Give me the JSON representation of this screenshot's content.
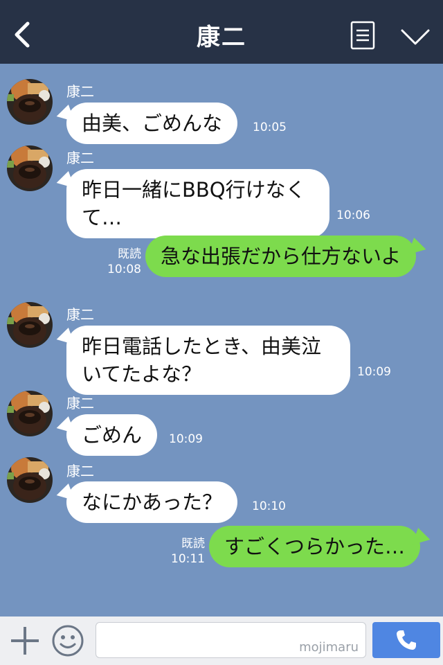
{
  "header": {
    "title": "康二",
    "back_icon": "chevron-left-icon",
    "menu_icon": "note-icon",
    "expand_icon": "chevron-down-icon",
    "bg_color": "#273246"
  },
  "chat": {
    "background_color": "#7494c0",
    "incoming_bubble_color": "#ffffff",
    "outgoing_bubble_color": "#7ddb4d",
    "messages": [
      {
        "sender": "康二",
        "text": "由美、ごめんな",
        "time": "10:05"
      },
      {
        "sender": "康二",
        "line1": "昨日一緒にBBQ行けなく",
        "line2": "て…",
        "time": "10:06"
      },
      {
        "text": "急な出張だから仕方ないよ",
        "read": "既読",
        "time": "10:08"
      },
      {
        "sender": "康二",
        "line1": "昨日電話したとき、由美泣",
        "line2": "いてたよな？",
        "time": "10:09"
      },
      {
        "sender": "康二",
        "text": "ごめん",
        "time": "10:09"
      },
      {
        "sender": "康二",
        "text": "なにかあった？",
        "time": "10:10"
      },
      {
        "text": "すごくつらかった…",
        "read": "既読",
        "time": "10:11"
      }
    ]
  },
  "footer": {
    "plus_icon": "plus-icon",
    "emoji_icon": "smile-icon",
    "input_value": "",
    "watermark": "mojimaru",
    "call_icon": "phone-icon",
    "call_button_color": "#4f86e2"
  }
}
